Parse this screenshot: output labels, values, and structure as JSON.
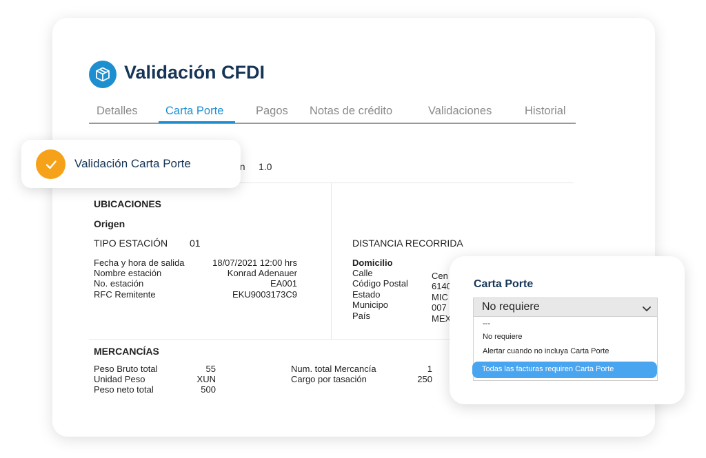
{
  "header": {
    "title": "Validación CFDI",
    "logo_icon": "package-box-icon",
    "brand_color": "#1d8fd0",
    "title_color": "#163456"
  },
  "tabs": [
    {
      "label": "Detalles",
      "active": false
    },
    {
      "label": "Carta Porte",
      "active": true
    },
    {
      "label": "Pagos",
      "active": false
    },
    {
      "label": "Notas de crédito",
      "active": false
    },
    {
      "label": "Validaciones",
      "active": false
    },
    {
      "label": "Historial",
      "active": false
    }
  ],
  "version": {
    "label_fragment": "ón",
    "value": "1.0"
  },
  "ubicaciones": {
    "heading": "UBICACIONES",
    "origen_label": "Origen",
    "tipo_estacion_label": "TIPO ESTACIÓN",
    "tipo_estacion_value": "01",
    "rows": [
      {
        "label": "Fecha y hora de salida",
        "value": "18/07/2021 12:00 hrs"
      },
      {
        "label": "Nombre estación",
        "value": "Konrad Adenauer"
      },
      {
        "label": "No. estación",
        "value": "EA001"
      },
      {
        "label": "RFC Remitente",
        "value": "EKU9003173C9"
      }
    ],
    "distancia_label": "DISTANCIA RECORRIDA",
    "domicilio_label": "Domicilio",
    "domicilio_rows": [
      {
        "label": "Calle",
        "value": "Cen"
      },
      {
        "label": "Código Postal",
        "value": "6140"
      },
      {
        "label": "Estado",
        "value": "MIC"
      },
      {
        "label": "Municipo",
        "value": "007"
      },
      {
        "label": "País",
        "value": "MEX"
      }
    ]
  },
  "mercancias": {
    "heading": "MERCANCÍAS",
    "left_rows": [
      {
        "label": "Peso Bruto total",
        "value": "55"
      },
      {
        "label": "Unidad Peso",
        "value": "XUN"
      },
      {
        "label": "Peso neto total",
        "value": "500"
      }
    ],
    "right_rows": [
      {
        "label": "Num. total Mercancía",
        "value": "1"
      },
      {
        "label": "Cargo por tasación",
        "value": "250"
      }
    ]
  },
  "toast": {
    "text": "Validación Carta Porte",
    "icon": "check-icon",
    "color": "#f5a21a"
  },
  "popup": {
    "title": "Carta Porte",
    "selected_value": "No requiere",
    "options": [
      "---",
      "No requiere",
      "Alertar cuando no incluya Carta Porte",
      "Todas las facturas requiren Carta Porte"
    ],
    "highlight_color": "#4aa5f0"
  }
}
